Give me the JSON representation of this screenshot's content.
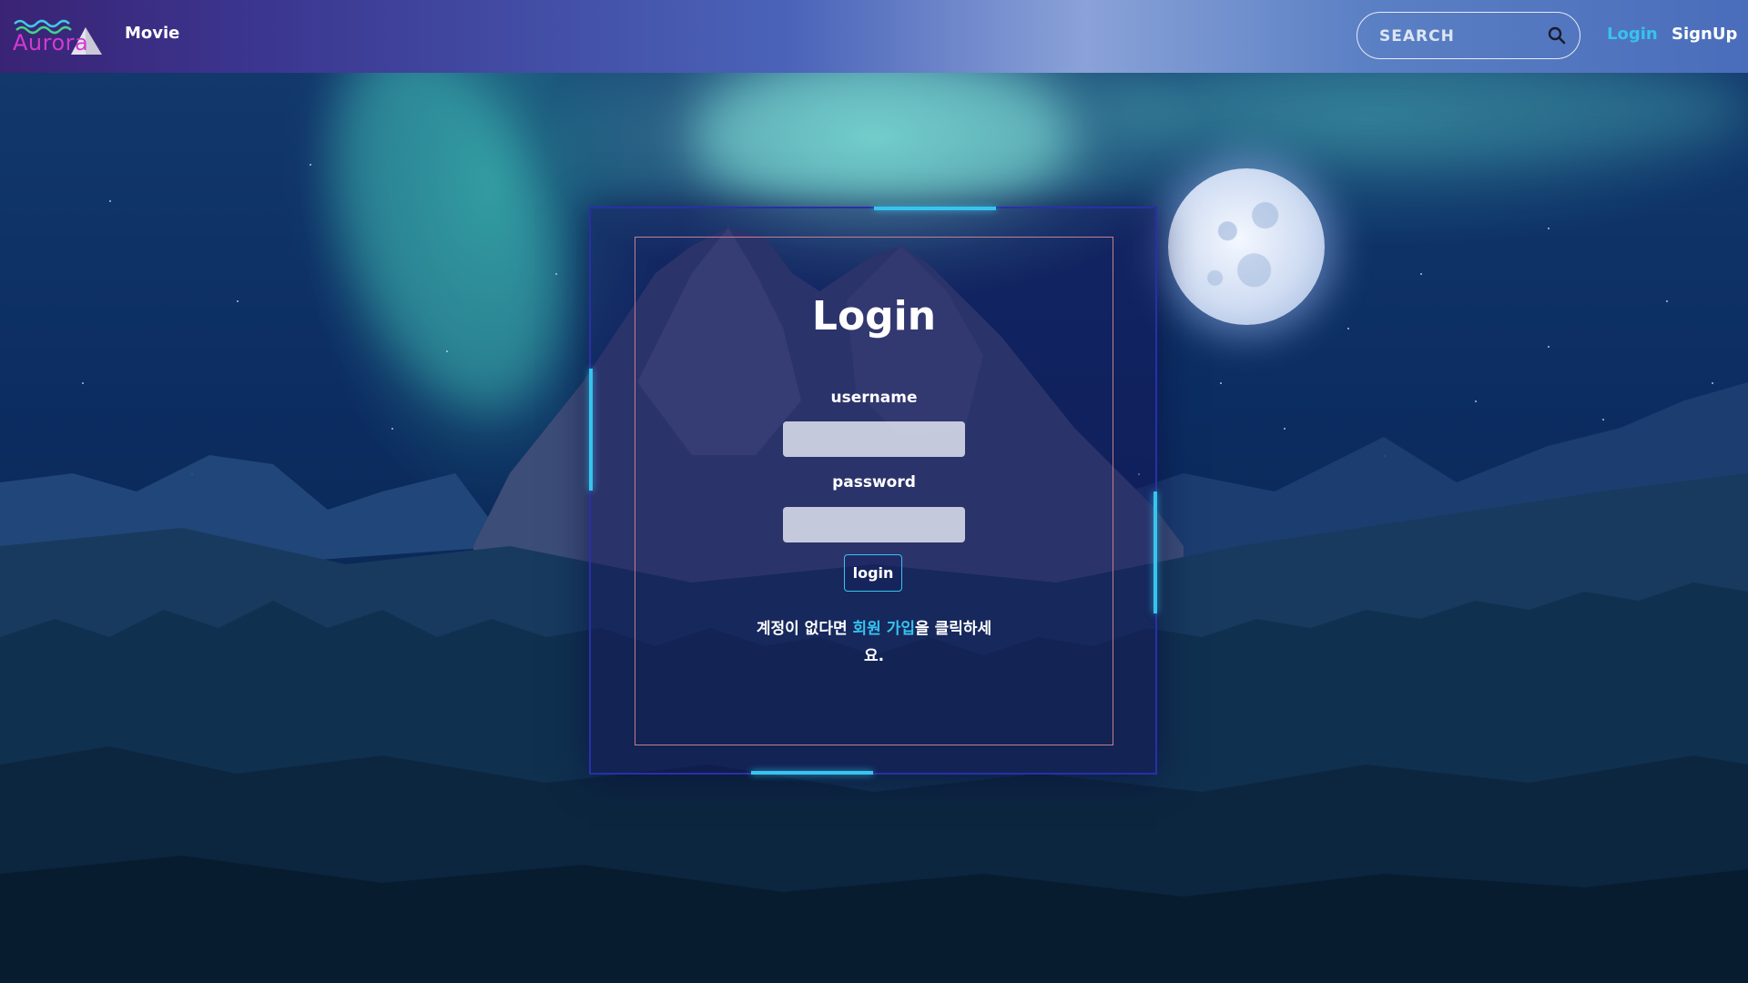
{
  "header": {
    "logo_text": "Aurora",
    "nav_movie": "Movie",
    "search_placeholder": "SEARCH",
    "nav_login": "Login",
    "nav_signup": "SignUp"
  },
  "login_card": {
    "title": "Login",
    "username_label": "username",
    "username_value": "",
    "password_label": "password",
    "password_value": "",
    "submit_label": "login",
    "signup_prefix": "계정이 없다면 ",
    "signup_link": "회원 가입",
    "signup_suffix": "을 클릭하세요."
  },
  "colors": {
    "accent": "#36c3ef",
    "logo": "#d23ad0",
    "card_border": "#2a2fa8",
    "inner_border": "#c77d8e"
  },
  "icons": {
    "search": "search-icon",
    "logo": "aurora-logo-icon"
  }
}
